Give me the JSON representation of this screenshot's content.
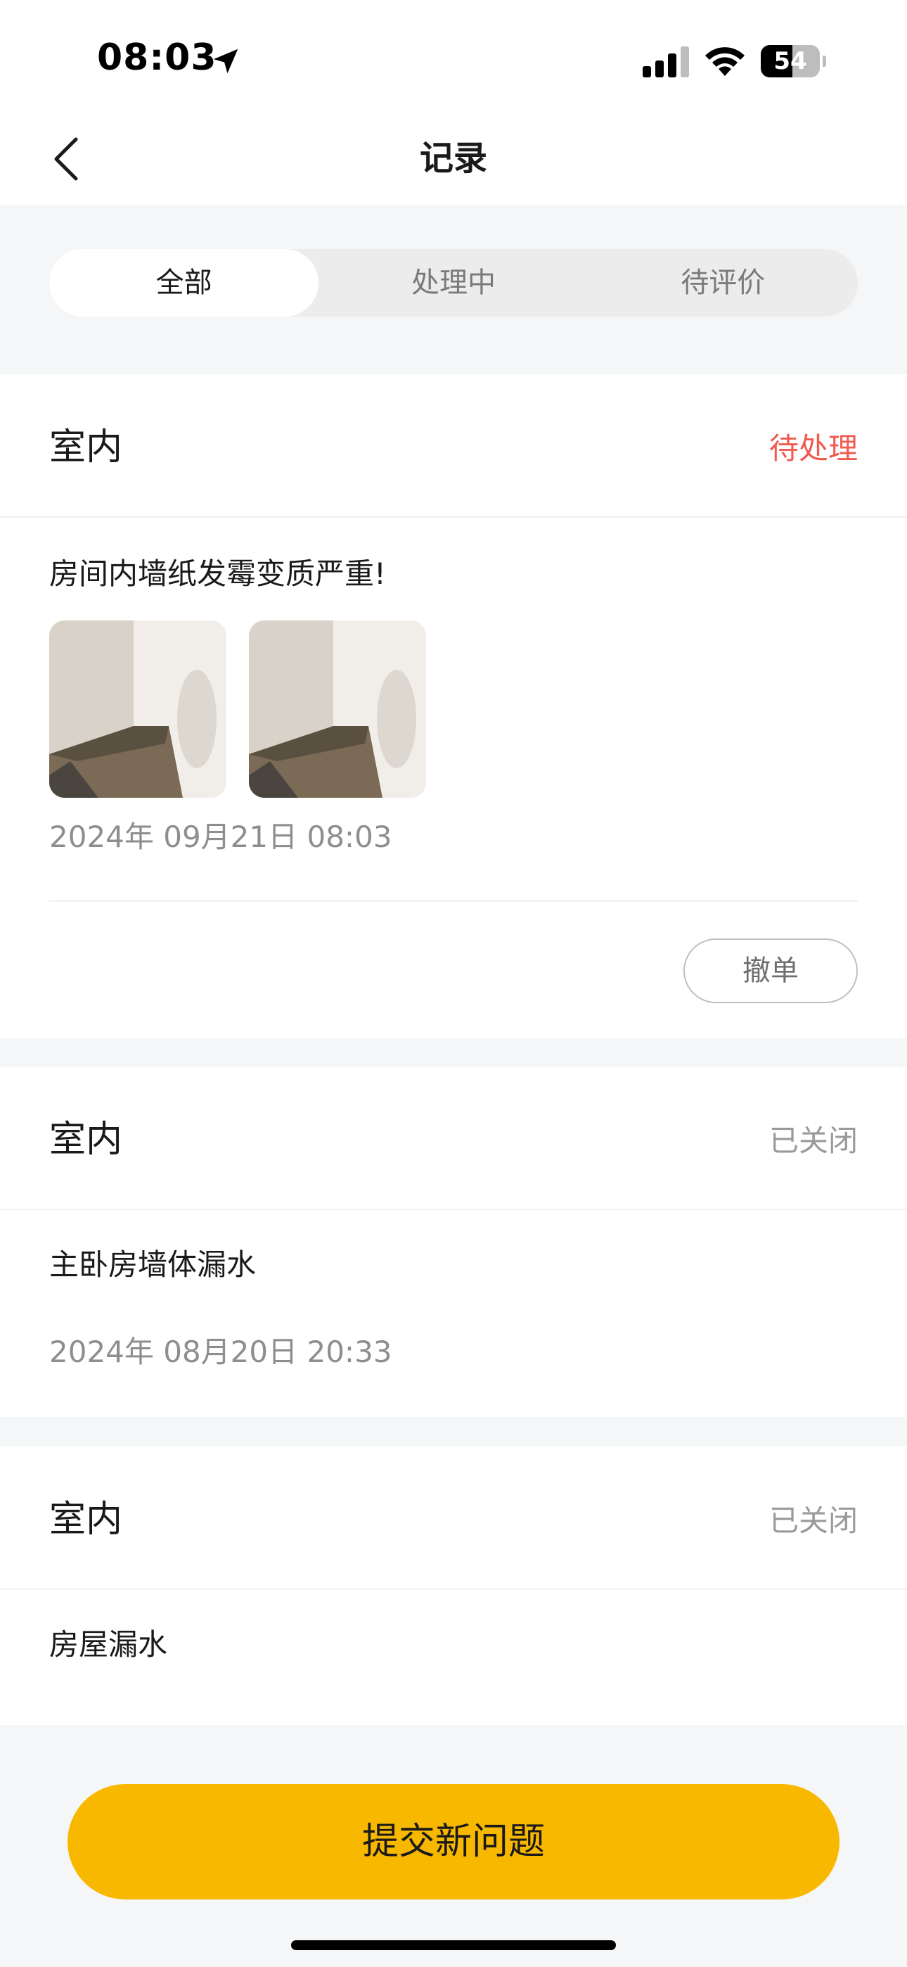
{
  "status_bar": {
    "time": "08:03",
    "battery_level": 54,
    "battery_text": "54",
    "icons": [
      "location-arrow-icon",
      "signal-icon",
      "wifi-icon",
      "battery-icon"
    ]
  },
  "nav": {
    "title": "记录",
    "back_icon": "chevron-left-icon"
  },
  "tabs": [
    {
      "label": "全部",
      "active": true
    },
    {
      "label": "处理中",
      "active": false
    },
    {
      "label": "待评价",
      "active": false
    }
  ],
  "records": [
    {
      "category": "室内",
      "status": "待处理",
      "status_color": "#f05a4f",
      "description": "房间内墙纸发霉变质严重!",
      "photos": 2,
      "time": "2024年 09月21日 08:03",
      "action": "撤单"
    },
    {
      "category": "室内",
      "status": "已关闭",
      "status_color": "#9a9a9a",
      "description": "主卧房墙体漏水",
      "time": "2024年 08月20日 20:33"
    },
    {
      "category": "室内",
      "status": "已关闭",
      "status_color": "#9a9a9a",
      "description": "房屋漏水"
    }
  ],
  "colors": {
    "accent": "#f8b800",
    "pending": "#f05a4f",
    "closed": "#9a9a9a",
    "background": "#f5f6f7"
  },
  "submit": {
    "label": "提交新问题"
  }
}
